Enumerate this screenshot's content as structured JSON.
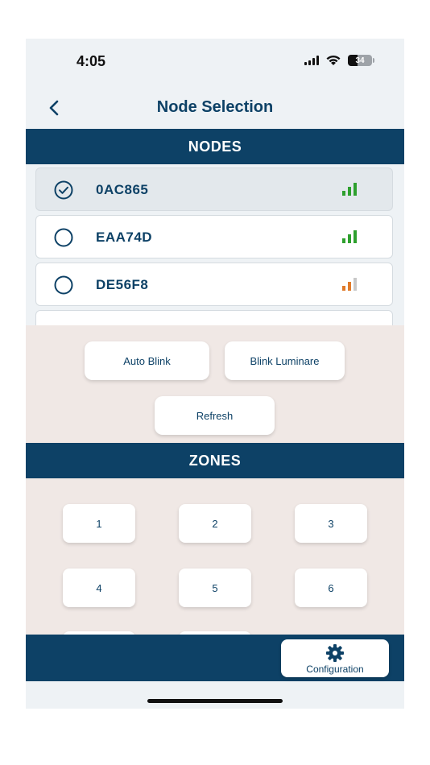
{
  "status_bar": {
    "time": "4:05",
    "battery": "34"
  },
  "header": {
    "title": "Node Selection"
  },
  "nodes_section": {
    "title": "NODES"
  },
  "nodes": [
    {
      "id": "0AC865",
      "selected": true,
      "signal": 3
    },
    {
      "id": "EAA74D",
      "selected": false,
      "signal": 3
    },
    {
      "id": "DE56F8",
      "selected": false,
      "signal": 2
    }
  ],
  "actions": {
    "auto_blink": "Auto Blink",
    "blink_luminare": "Blink Luminare",
    "refresh": "Refresh"
  },
  "zones_section": {
    "title": "ZONES"
  },
  "zones": [
    "1",
    "2",
    "3",
    "4",
    "5",
    "6"
  ],
  "bottom_bar": {
    "configuration": "Configuration"
  },
  "colors": {
    "primary": "#0d4166",
    "signal_strong": "#2ea02e",
    "signal_medium": "#e07b2a",
    "signal_empty": "#c8c8c8",
    "panel_bg": "#f0e8e5"
  }
}
